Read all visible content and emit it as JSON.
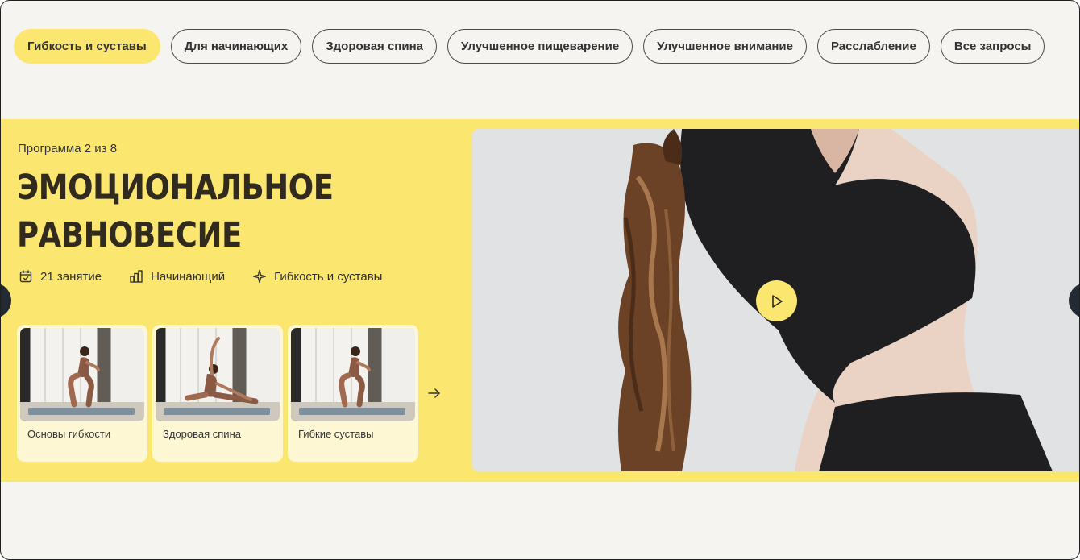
{
  "filters": {
    "chips": [
      {
        "label": "Гибкость и суставы",
        "active": true
      },
      {
        "label": "Для начинающих",
        "active": false
      },
      {
        "label": "Здоровая спина",
        "active": false
      },
      {
        "label": "Улучшенное пищеварение",
        "active": false
      },
      {
        "label": "Улучшенное внимание",
        "active": false
      },
      {
        "label": "Расслабление",
        "active": false
      },
      {
        "label": "Все запросы",
        "active": false
      }
    ]
  },
  "program": {
    "counter": "Программа 2 из 8",
    "title_line1": "ЭМОЦИОНАЛЬНОЕ",
    "title_line2": "РАВНОВЕСИЕ",
    "meta": [
      {
        "icon": "calendar-icon",
        "label": "21 занятие"
      },
      {
        "icon": "level-bars-icon",
        "label": "Начинающий"
      },
      {
        "icon": "sparkle-icon",
        "label": "Гибкость и суставы"
      }
    ],
    "lessons": [
      {
        "label": "Основы гибкости",
        "pose": "squat"
      },
      {
        "label": "Здоровая спина",
        "pose": "side-stretch"
      },
      {
        "label": "Гибкие суставы",
        "pose": "squat"
      }
    ]
  },
  "colors": {
    "accent": "#fbe66f",
    "page_bg": "#f6f4f1",
    "card_bg": "#fdf7d4",
    "nav_button": "#242a33",
    "text": "#312b1f"
  },
  "icons": {
    "play": "play-icon",
    "next_lessons": "arrow-right-icon",
    "carousel_prev": "chevron-left-icon",
    "carousel_next": "chevron-right-icon"
  }
}
